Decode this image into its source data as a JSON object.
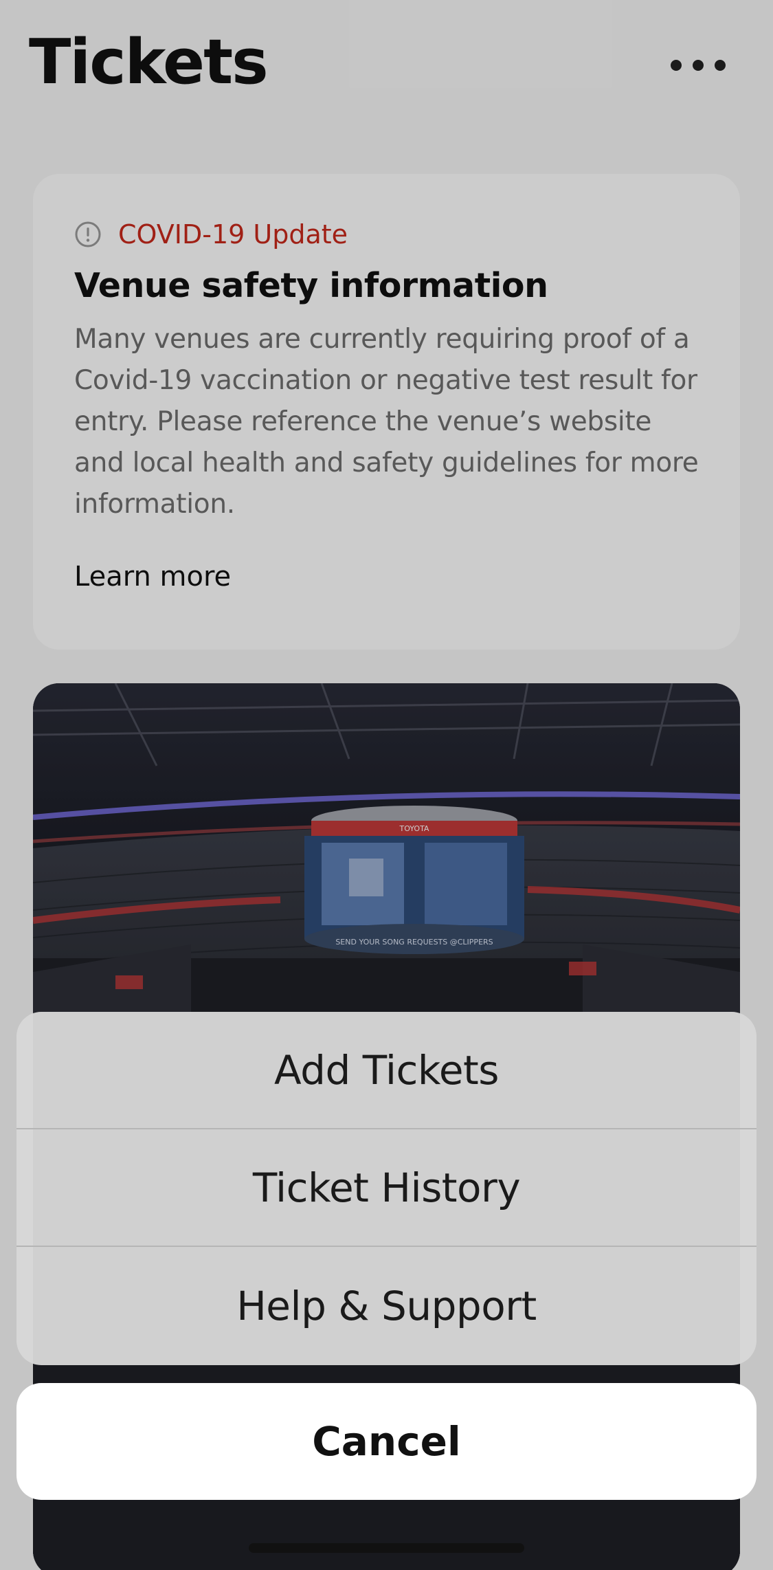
{
  "header": {
    "title": "Tickets",
    "more_icon": "ellipsis-icon"
  },
  "covid_card": {
    "icon": "alert-circle-icon",
    "tag": "COVID-19 Update",
    "title": "Venue safety information",
    "body": "Many venues are currently requiring proof of a Covid-19 vaccination or negative test result for entry. Please reference the venue’s website and local health and safety guidelines for more information.",
    "link": "Learn more",
    "tag_color": "#c8281b"
  },
  "event_image": {
    "scoreboard_brand": "TOYOTA",
    "scoreboard_caption": "SEND YOUR SONG REQUESTS @CLIPPERS"
  },
  "action_sheet": {
    "items": [
      "Add Tickets",
      "Ticket History",
      "Help & Support"
    ],
    "cancel_label": "Cancel"
  }
}
